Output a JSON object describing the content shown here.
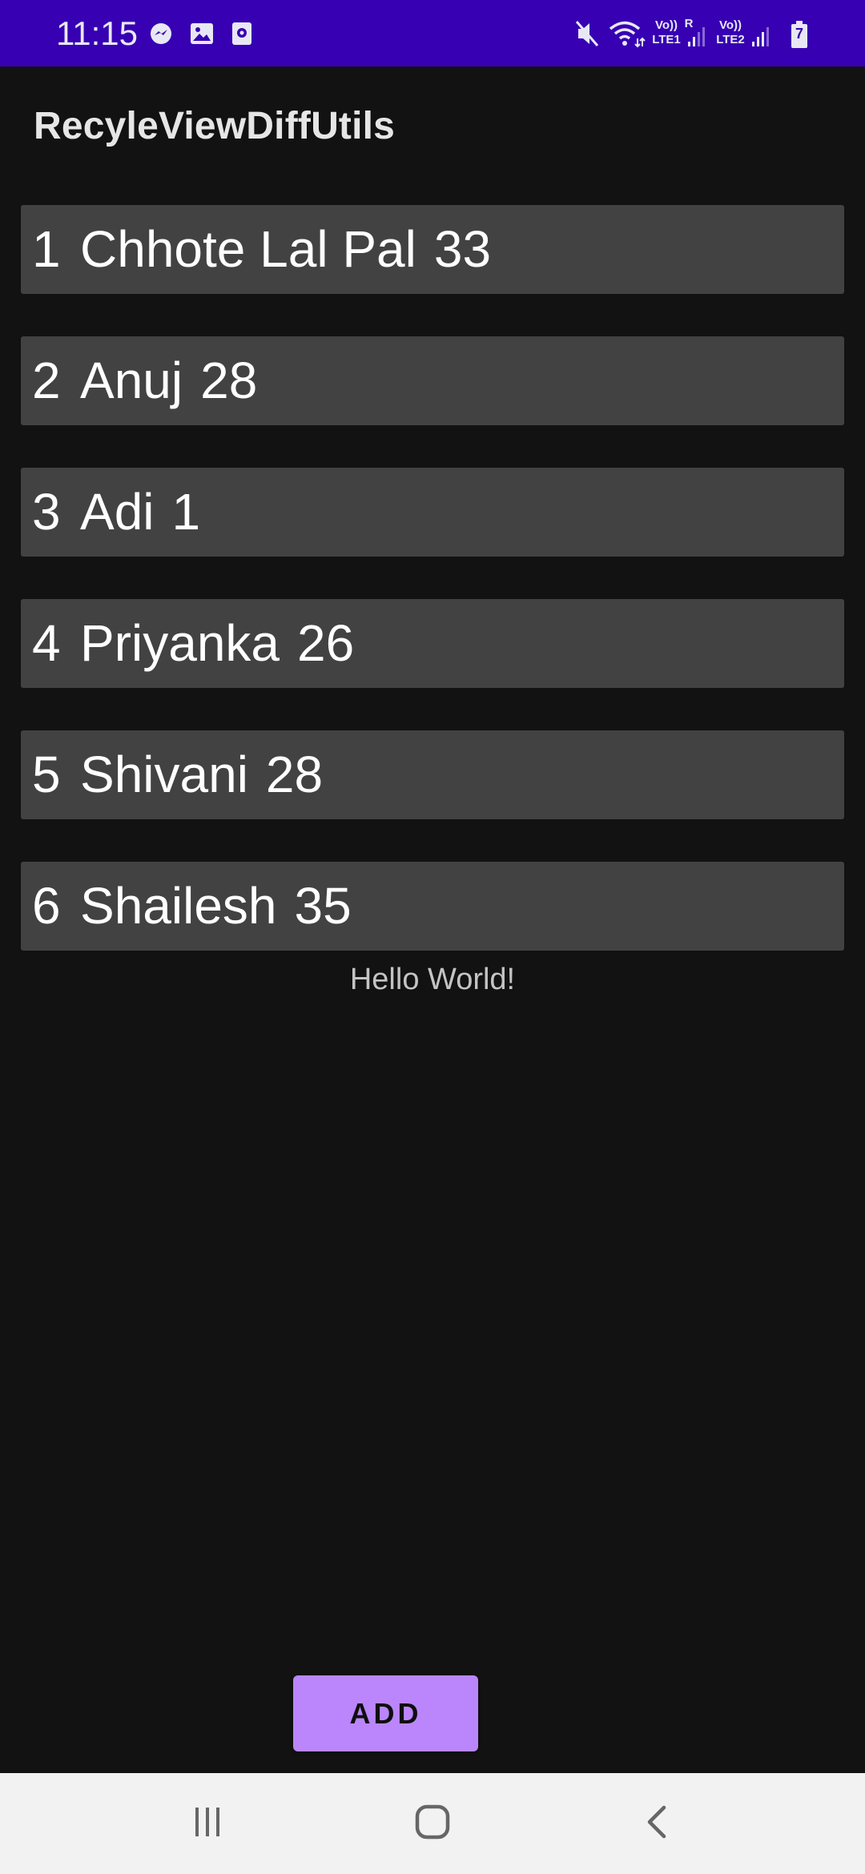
{
  "status_bar": {
    "time": "11:15",
    "sim1_label_top": "Vo))",
    "sim1_label_bottom": "LTE1",
    "sim1_roaming": "R",
    "sim2_label_top": "Vo))",
    "sim2_label_bottom": "LTE2",
    "battery_level": "7",
    "left_icons": [
      "messenger-icon",
      "gallery-icon",
      "screen-recorder-icon"
    ],
    "right_icons": [
      "mute-icon",
      "wifi-icon",
      "signal-sim1-icon",
      "signal-sim2-icon",
      "battery-charging-icon"
    ]
  },
  "app": {
    "title": "RecyleViewDiffUtils"
  },
  "list": {
    "items": [
      {
        "id": "1",
        "name": "Chhote Lal Pal",
        "age": "33"
      },
      {
        "id": "2",
        "name": "Anuj",
        "age": "28"
      },
      {
        "id": "3",
        "name": "Adi",
        "age": "1"
      },
      {
        "id": "4",
        "name": "Priyanka",
        "age": "26"
      },
      {
        "id": "5",
        "name": "Shivani",
        "age": "28"
      },
      {
        "id": "6",
        "name": "Shailesh",
        "age": "35"
      }
    ]
  },
  "hello_text": "Hello World!",
  "add_button": {
    "label": "ADD"
  },
  "nav_bar": {
    "buttons": [
      "recent-apps-icon",
      "home-icon",
      "back-icon"
    ]
  },
  "colors": {
    "status_bar": "#3700b3",
    "background": "#121212",
    "list_item": "#424242",
    "accent_button": "#bb86fc",
    "nav_bar": "#f2f2f2"
  }
}
